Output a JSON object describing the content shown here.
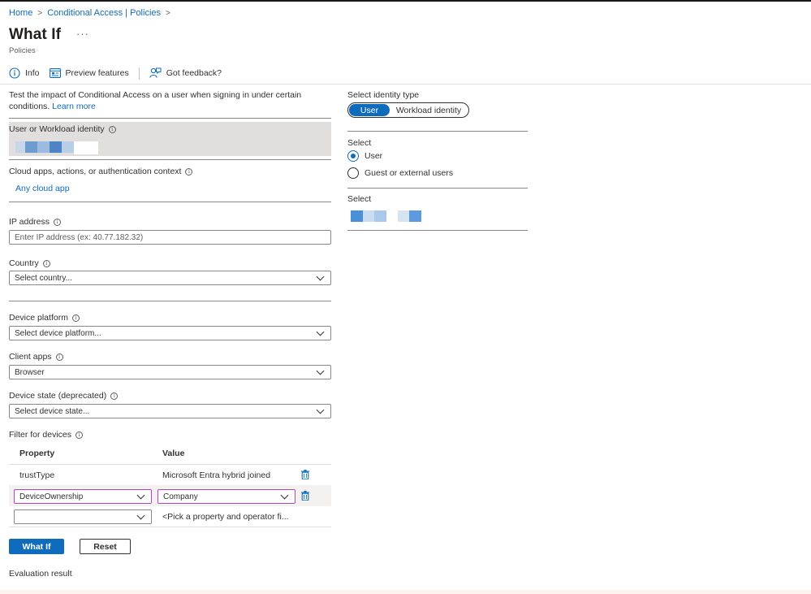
{
  "breadcrumb": [
    {
      "label": "Home"
    },
    {
      "label": "Conditional Access | Policies"
    }
  ],
  "page": {
    "title": "What If",
    "more": "···",
    "subtitle": "Policies"
  },
  "toolbar": {
    "info": "Info",
    "preview": "Preview features",
    "feedback": "Got feedback?"
  },
  "intro": {
    "text": "Test the impact of Conditional Access on a user when signing in under certain conditions.",
    "learn_more": "Learn more"
  },
  "identity": {
    "label": "User or Workload identity"
  },
  "cloud_apps": {
    "label": "Cloud apps, actions, or authentication context",
    "value": "Any cloud app"
  },
  "ip": {
    "label": "IP address",
    "placeholder": "Enter IP address (ex: 40.77.182.32)"
  },
  "country": {
    "label": "Country",
    "value": "Select country..."
  },
  "device_platform": {
    "label": "Device platform",
    "value": "Select device platform..."
  },
  "client_apps": {
    "label": "Client apps",
    "value": "Browser"
  },
  "device_state": {
    "label": "Device state (deprecated)",
    "value": "Select device state..."
  },
  "filter": {
    "label": "Filter for devices",
    "columns": [
      "Property",
      "Value"
    ],
    "rows": [
      {
        "property": "trustType",
        "value": "Microsoft Entra hybrid joined"
      },
      {
        "property": "DeviceOwnership",
        "value": "Company"
      },
      {
        "property": "",
        "value": "<Pick a property and operator fi..."
      }
    ]
  },
  "actions": {
    "whatif": "What If",
    "reset": "Reset"
  },
  "evaluation": {
    "label": "Evaluation result"
  },
  "right": {
    "identity_type_label": "Select identity type",
    "toggle": {
      "on": "User",
      "off": "Workload identity"
    },
    "select_label": "Select",
    "radios": [
      {
        "label": "User",
        "checked": true
      },
      {
        "label": "Guest or external users",
        "checked": false
      }
    ],
    "select2_label": "Select"
  },
  "colors": {
    "accent": "#0f6cbd",
    "highlight_border": "#b146c2",
    "blur_dark": "#4a90d9",
    "blur_light": "#a9c9ea"
  }
}
